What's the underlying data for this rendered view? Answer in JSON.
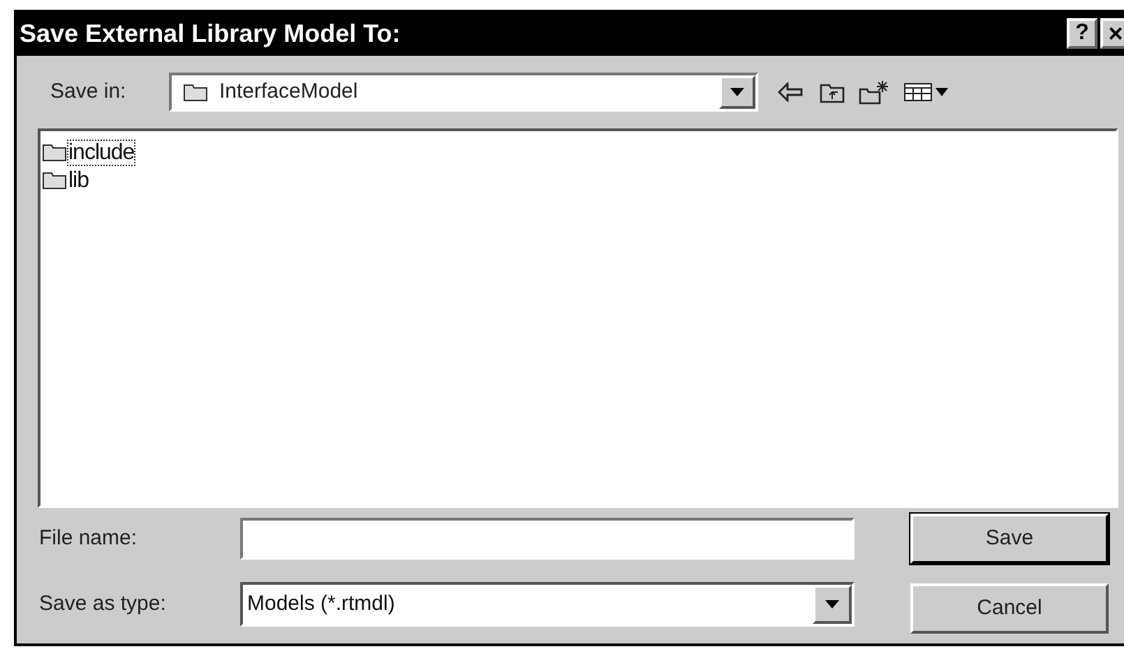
{
  "window": {
    "title": "Save External Library Model To:",
    "help_button": "?",
    "close_button": "×"
  },
  "save_in": {
    "label": "Save in:",
    "value": "InterfaceModel"
  },
  "files": [
    {
      "name": "include",
      "selected": true
    },
    {
      "name": "lib",
      "selected": false
    }
  ],
  "file_name": {
    "label": "File name:"
  },
  "save_as_type": {
    "label": "Save as type:",
    "value": "Models (*.rtmdl)"
  },
  "buttons": [
    {
      "label": "Save",
      "default": true
    },
    {
      "label": "Cancel",
      "default": false
    }
  ]
}
